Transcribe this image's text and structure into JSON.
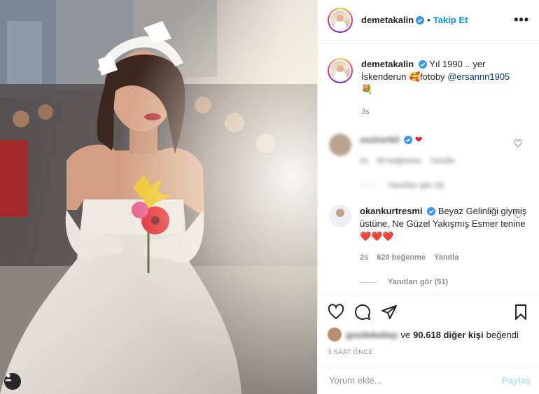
{
  "header": {
    "username": "demetakalin",
    "separator": "•",
    "follow_label": "Takip Et",
    "more_label": "•••"
  },
  "caption": {
    "username": "demetakalin",
    "text_1": "Yıl 1990 .. yer İskenderun",
    "emoji_1": "🥰",
    "text_2": "fotoby",
    "mention": "@ersannn1905",
    "emoji_2": "💐",
    "time": "3s"
  },
  "comments": [
    {
      "username": "vezirerkil",
      "emoji": "❤",
      "time": "2s",
      "likes": "93 beğenme",
      "reply_label": "Yanıtla",
      "view_replies": "Yanıtları gör (3)"
    },
    {
      "username": "okankurtresmi",
      "text": "Beyaz Gelinliği giymiş üstüne, Ne Güzel Yakışmış Esmer tenine",
      "emoji": "❤️❤️❤️",
      "time": "2s",
      "likes": "620 beğenme",
      "reply_label": "Yanıtla",
      "view_replies": "Yanıtları gör (51)"
    }
  ],
  "likes": {
    "blurred_user": "gozdekaltay",
    "joiner": "ve",
    "others": "90.618 diğer kişi",
    "suffix": "beğendi"
  },
  "time_ago": "3 SAAT ÖNCE",
  "add_comment": {
    "placeholder": "Yorum ekle...",
    "post_label": "Paylaş"
  },
  "icons": {
    "verified": "verified-badge-icon",
    "heart": "heart-icon",
    "comment": "comment-icon",
    "share": "share-icon",
    "bookmark": "bookmark-icon",
    "user_tag": "user-tag-icon"
  },
  "colors": {
    "link": "#0095f6",
    "verified": "#3897f0",
    "mention": "#00376b",
    "muted": "#8e8e8e",
    "post_disabled": "#b2dffc"
  }
}
